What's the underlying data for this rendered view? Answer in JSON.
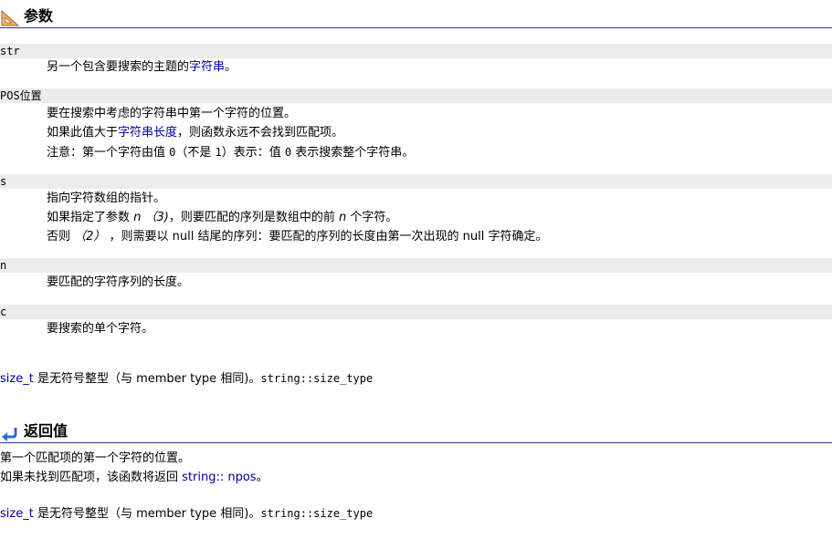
{
  "parameters": {
    "heading": "参数",
    "str": {
      "name": "str",
      "desc_before": "另一个包含要搜索的主题的",
      "desc_link": "字符串",
      "desc_after": "。"
    },
    "pos": {
      "name": "POS位置",
      "line1": "要在搜索中考虑的字符串中第一个字符的位置。",
      "line2_before": "如果此值大于",
      "line2_link": "字符串长度",
      "line2_after": "，则函数永远不会找到匹配项。",
      "line3_a": "注意：第一个字符由值 ",
      "line3_b": "0",
      "line3_c": "（不是 ",
      "line3_d": "1",
      "line3_e": "）表示：值 ",
      "line3_f": "0",
      "line3_g": " 表示搜索整个字符串。"
    },
    "s": {
      "name": "s",
      "line1": "指向字符数组的指针。",
      "line2_a": "如果指定了参数 ",
      "line2_b": "n （3)",
      "line2_c": "，则要匹配的序列是数组中的前 ",
      "line2_d": "n",
      "line2_e": " 个字符。",
      "line3_a": "否则 ",
      "line3_b": "（2）",
      "line3_c": " ，则需要以 null 结尾的序列：要匹配的序列的长度由第一次出现的 null 字符确定。"
    },
    "n": {
      "name": "n",
      "desc": "要匹配的字符序列的长度。"
    },
    "c": {
      "name": "c",
      "desc": "要搜索的单个字符。"
    },
    "size_note": {
      "link": "size_t",
      "text": " 是无符号整型（与 member type 相同)。",
      "code": "string::size_type"
    }
  },
  "return_value": {
    "heading": "返回值",
    "line1": "第一个匹配项的第一个字符的位置。",
    "line2_before": "如果未找到匹配项，该函数将返回 ",
    "line2_link": "string:: npos",
    "line2_after": "。",
    "size_note": {
      "link": "size_t",
      "text": " 是无符号整型（与 member type 相同)。",
      "code": "string::size_type"
    }
  }
}
